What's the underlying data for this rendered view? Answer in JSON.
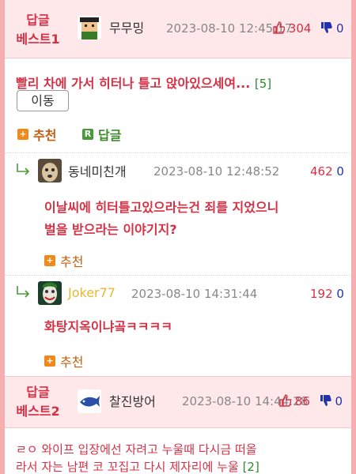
{
  "best1": {
    "badge_line1": "답글",
    "badge_line2": "베스트1",
    "author": "무무밍",
    "date": "2023-08-10 12:45:17",
    "up": "304",
    "down": "0",
    "title": "빨리 차에 가서 히터나 틀고 앉아있으세여...",
    "reply_count": "[5]",
    "move_label": "이동",
    "recommend_label": "추천",
    "reply_label": "답글"
  },
  "replies": [
    {
      "author": "동네미친개",
      "date": "2023-08-10 12:48:52",
      "up": "462",
      "down": "0",
      "text_line1": "이날씨에 히터틀고있으라는건 죄를 지었으니",
      "text_line2": "벌을 받으라는 이야기지?",
      "recommend_label": "추천"
    },
    {
      "author": "Joker77",
      "date": "2023-08-10 14:31:44",
      "up": "192",
      "down": "0",
      "text_line1": "화탕지옥이냐곸ㅋㅋㅋㅋ",
      "recommend_label": "추천",
      "author_color": "#e8b830"
    }
  ],
  "best2": {
    "badge_line1": "답글",
    "badge_line2": "베스트2",
    "author": "찰진방어",
    "date": "2023-08-10 14:44:28",
    "up": "86",
    "down": "0",
    "body_line1": "ㄹㅇ 와이프 입장에선 자려고 누울때 다시금 떠올",
    "body_line2": "라서 자는 남편 코 꼬집고 다시 제자리에 누울",
    "body_count": "[2]"
  },
  "colors": {
    "accent": "#d63045",
    "green": "#2d8a2d",
    "blue": "#2233aa",
    "bg": "#f7aeb1"
  }
}
